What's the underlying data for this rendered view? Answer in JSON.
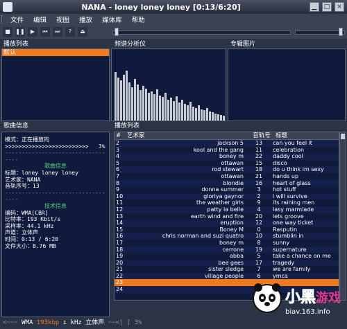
{
  "window": {
    "title": "NANA - loney loney loney [0:13/6:20]"
  },
  "menu": [
    "文件",
    "编辑",
    "视图",
    "播放",
    "媒体库",
    "帮助"
  ],
  "panels": {
    "playlists": "播放列表",
    "spectrum": "频谱分析仪",
    "album": "专辑图片",
    "songinfo": "歌曲信息",
    "playlist": "播放列表"
  },
  "playlists": {
    "selected": "默认"
  },
  "info": {
    "mode_label": "模式：",
    "mode_value": "正在播放的",
    "progress": ">>>>>>>>>>>>>>>>>>>>>>>>>",
    "progress_pct": "3%",
    "sec1": "歌曲信息",
    "title_label": "标题：",
    "title_value": "loney loney loney",
    "artist_label": "艺术家：",
    "artist_value": "NANA",
    "track_label": "音轨序号：",
    "track_value": "13",
    "sec2": "技术信息",
    "codec_label": "编码：",
    "codec_value": "WMA[CBR]",
    "bitrate_label": "比特率：",
    "bitrate_value": "193 Kbit/s",
    "samplerate_label": "采样率：",
    "samplerate_value": "44.1 kHz",
    "channel_label": "声道：",
    "channel_value": "立体声",
    "time_label": "时间：",
    "time_value": "0:13 / 6:20",
    "size_label": "文件大小：",
    "size_value": "8.76 MB"
  },
  "table": {
    "headers": [
      "#",
      "艺术家",
      "音轨号",
      "标题"
    ],
    "rows": [
      [
        "2",
        "jackson 5",
        "13",
        "can you feel it"
      ],
      [
        "3",
        "kool and the gang",
        "11",
        "celebration"
      ],
      [
        "4",
        "boney m",
        "22",
        "daddy cool"
      ],
      [
        "5",
        "ottawan",
        "15",
        "disco"
      ],
      [
        "6",
        "rod stewart",
        "18",
        "do u think im sexy"
      ],
      [
        "7",
        "ottawan",
        "21",
        "hands up"
      ],
      [
        "8",
        "blondie",
        "16",
        "heart of glass"
      ],
      [
        "9",
        "donna summer",
        "3",
        "hot stuff"
      ],
      [
        "10",
        "gloriya gaynor",
        "2",
        "i will survive"
      ],
      [
        "11",
        "the weather girls",
        "9",
        "its raining men"
      ],
      [
        "12",
        "patty la belle",
        "4",
        "lasy marmlade"
      ],
      [
        "13",
        "earth wind and fire",
        "20",
        "lets groove"
      ],
      [
        "14",
        "eruption",
        "12",
        "one way ticket"
      ],
      [
        "15",
        "Boney M",
        "0",
        "Rasputin"
      ],
      [
        "16",
        "chris norman and suzi quatro",
        "10",
        "stumblin in"
      ],
      [
        "17",
        "boney m",
        "8",
        "sunny"
      ],
      [
        "18",
        "cerrone",
        "19",
        "supernature"
      ],
      [
        "19",
        "abba",
        "5",
        "take a chance on me"
      ],
      [
        "20",
        "bee gees",
        "17",
        "tragedy"
      ],
      [
        "21",
        "sister sledge",
        "7",
        "we are family"
      ],
      [
        "22",
        "village people",
        "6",
        "ymca"
      ],
      [
        "23",
        "",
        "",
        ""
      ],
      [
        "24",
        "",
        "",
        ""
      ]
    ],
    "selected_row": 21
  },
  "status": {
    "prefix": "<~~~",
    "codec": "WMA",
    "bitrate": "193kbp",
    "rest": "ı kHz 立体声",
    "progress_text": "~~<| [ 3%"
  },
  "logo": {
    "text": "小黑游戏",
    "url_text": "biav.163.info"
  }
}
